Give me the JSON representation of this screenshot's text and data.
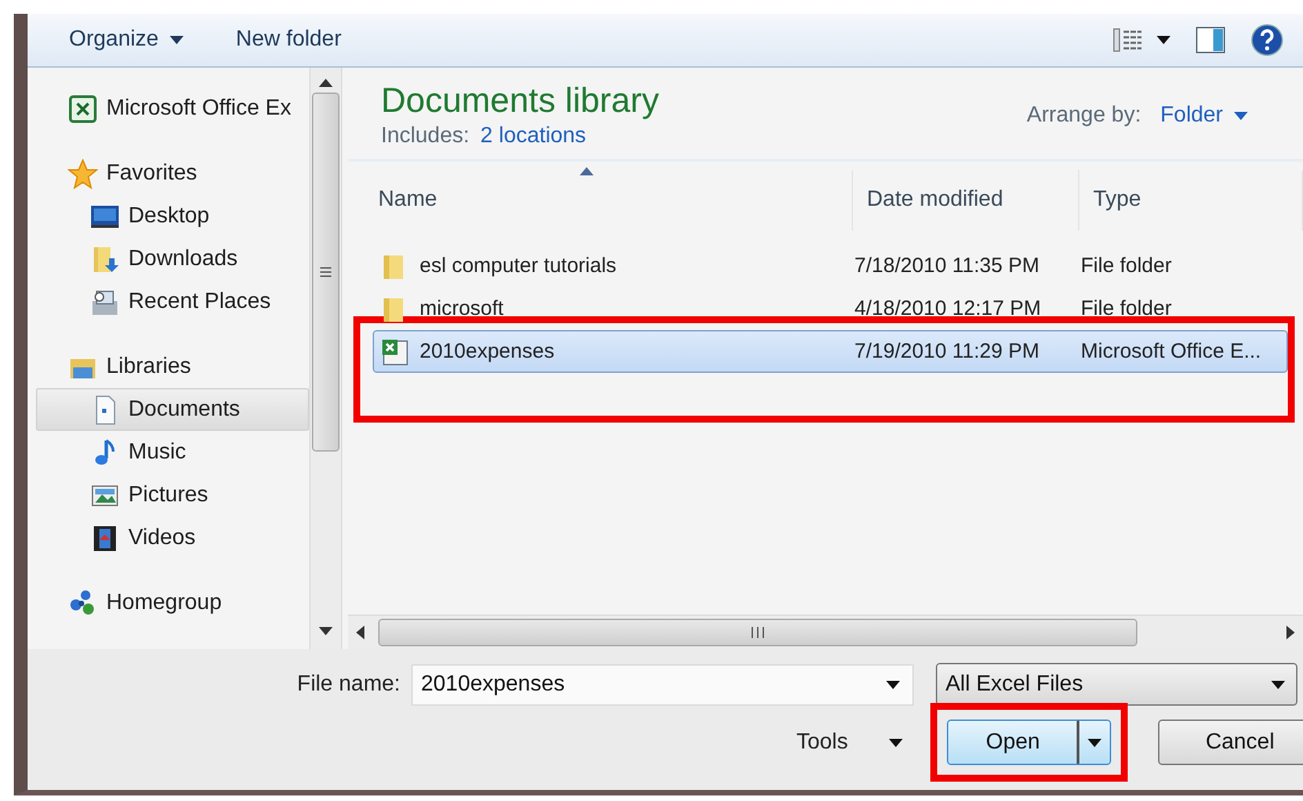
{
  "toolbar": {
    "buttons": [
      {
        "label": "Organize",
        "dropdown": true
      },
      {
        "label": "New folder",
        "dropdown": false
      }
    ]
  },
  "sidebar": {
    "items": [
      {
        "label": "Microsoft Office Ex",
        "kind": "excel",
        "selected": false
      },
      {
        "label": "Favorites",
        "kind": "star",
        "selected": false,
        "children": [
          {
            "label": "Desktop",
            "kind": "desktop",
            "selected": false
          },
          {
            "label": "Downloads",
            "kind": "downloads",
            "selected": false
          },
          {
            "label": "Recent Places",
            "kind": "recent",
            "selected": false
          }
        ]
      },
      {
        "label": "Libraries",
        "kind": "library",
        "selected": false,
        "children": [
          {
            "label": "Documents",
            "kind": "document",
            "selected": true
          },
          {
            "label": "Music",
            "kind": "music",
            "selected": false
          },
          {
            "label": "Pictures",
            "kind": "pictures",
            "selected": false
          },
          {
            "label": "Videos",
            "kind": "videos",
            "selected": false
          }
        ]
      },
      {
        "label": "Homegroup",
        "kind": "homegroup",
        "selected": false
      }
    ]
  },
  "library": {
    "title": "Documents library",
    "includes_label": "Includes:",
    "includes_link": "2 locations",
    "arrange_label": "Arrange by:",
    "arrange_value": "Folder"
  },
  "table": {
    "columns": [
      {
        "label": "Name",
        "sorted": true
      },
      {
        "label": "Date modified",
        "sorted": false
      },
      {
        "label": "Type",
        "sorted": false
      }
    ],
    "rows": [
      {
        "kind": "folder",
        "name": "esl computer tutorials",
        "date": "7/18/2010 11:35 PM",
        "type": "File folder",
        "selected": false,
        "highlighted": false
      },
      {
        "kind": "folder",
        "name": "microsoft",
        "date": "4/18/2010 12:17 PM",
        "type": "File folder",
        "selected": false,
        "highlighted": false
      },
      {
        "kind": "excel",
        "name": "2010expenses",
        "date": "7/19/2010 11:29 PM",
        "type": "Microsoft Office E...",
        "selected": true,
        "highlighted": true
      }
    ]
  },
  "footer": {
    "file_name_label": "File name:",
    "file_name": "2010expenses",
    "file_type": "All Excel Files",
    "tools": "Tools",
    "buttons": [
      {
        "label": "Open",
        "kind": "split",
        "highlighted": true
      },
      {
        "label": "Cancel",
        "kind": "plain",
        "highlighted": false
      }
    ]
  }
}
